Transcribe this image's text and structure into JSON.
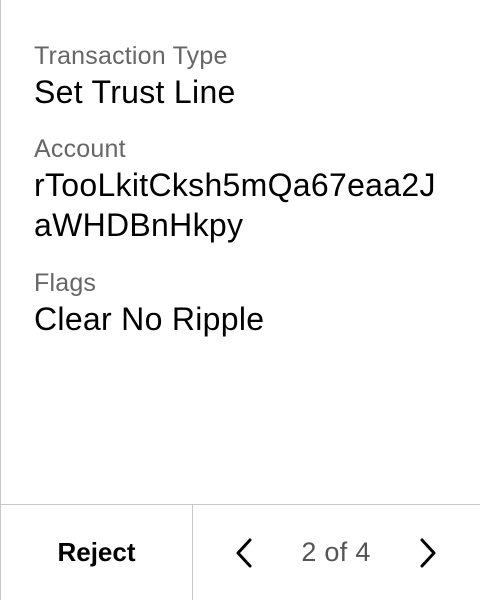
{
  "transaction": {
    "fields": [
      {
        "label": "Transaction Type",
        "value": "Set Trust Line"
      },
      {
        "label": "Account",
        "value": "rTooLkitCksh5mQa67eaa2JaWHDBnHkpy"
      },
      {
        "label": "Flags",
        "value": "Clear No Ripple"
      }
    ]
  },
  "footer": {
    "reject_label": "Reject",
    "page_indicator": "2 of 4",
    "prev_icon": "chevron-left-icon",
    "next_icon": "chevron-right-icon"
  }
}
